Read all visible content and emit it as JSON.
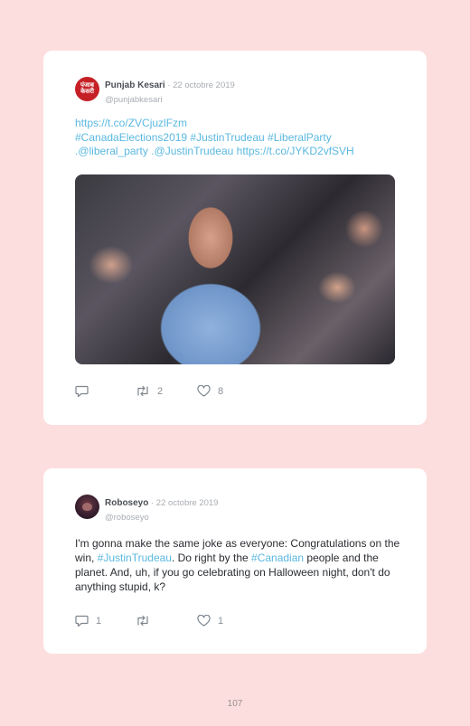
{
  "tweets": [
    {
      "avatar_text": "पंजाब केसरी",
      "name": "Punjab Kesari",
      "date": " · 22 octobre 2019",
      "handle": "@punjabkesari",
      "lines": [
        "https://t.co/ZVCjuzlFzm",
        "#CanadaElections2019 #JustinTrudeau #LiberalParty",
        ".@liberal_party .@JustinTrudeau https://t.co/JYKD2vfSVH"
      ],
      "reply_count": "",
      "retweet_count": "2",
      "like_count": "8"
    },
    {
      "name": "Roboseyo",
      "date": " · 22 octobre 2019",
      "handle": "@roboseyo",
      "text": {
        "p1": "I'm gonna make the same joke as everyone: Congratulations on the win, ",
        "tag1": "#JustinTrudeau",
        "p2": ". Do right by the ",
        "tag2": "#Canadian",
        "p3": " people and the planet. And, uh, if you go celebrating on Halloween night, don't do anything stupid, k?"
      },
      "reply_count": "1",
      "retweet_count": "",
      "like_count": "1"
    }
  ],
  "page_number": "107",
  "colors": {
    "background": "#fddede",
    "link": "#5ab8e0",
    "muted": "#a8adb3"
  }
}
